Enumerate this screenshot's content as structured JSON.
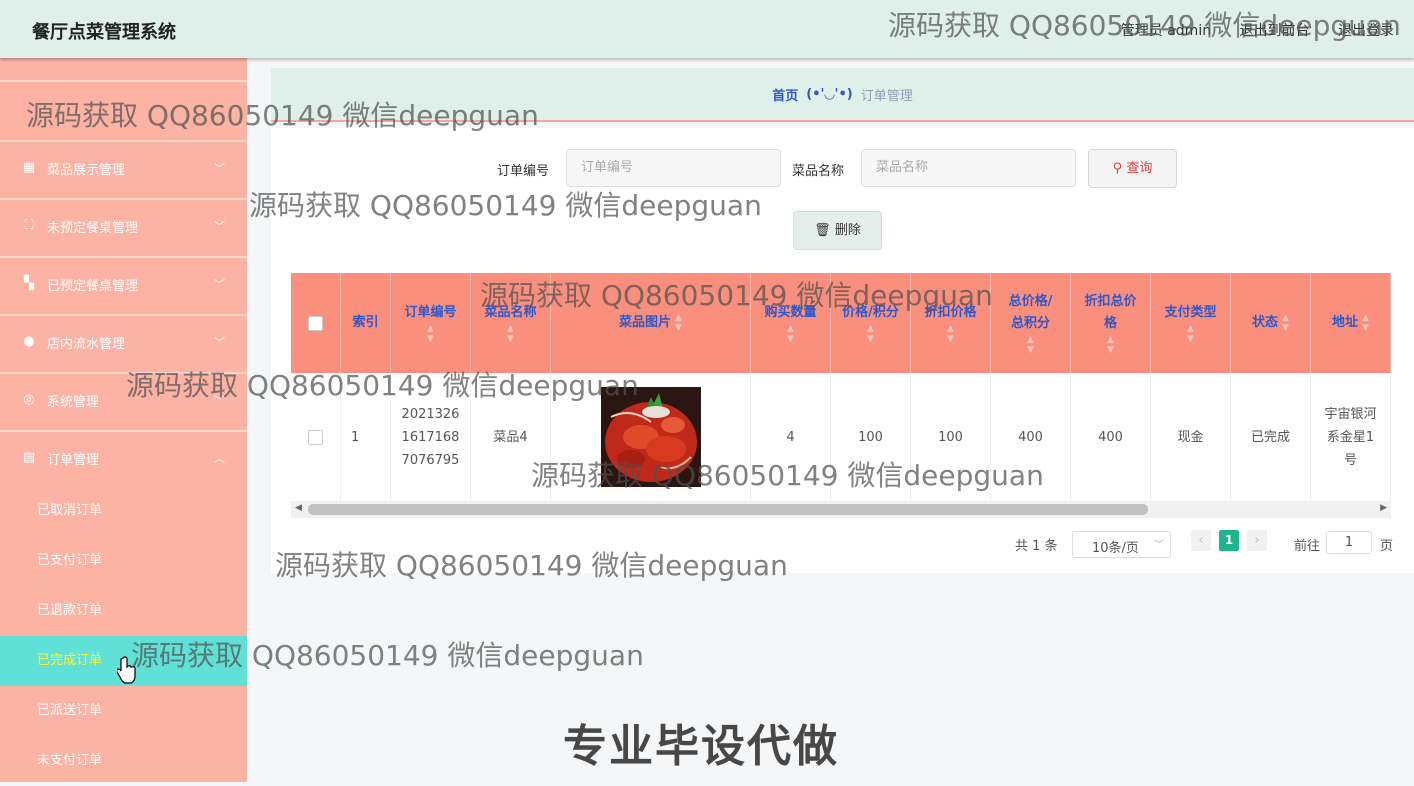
{
  "header": {
    "app_title": "餐厅点菜管理系统",
    "admin_label": "管理员 admin",
    "back_front": "退出到前台",
    "logout": "退出登录"
  },
  "sidebar": {
    "items": [
      {
        "label": "菜品展示管理",
        "icon": "grid-icon"
      },
      {
        "label": "未预定餐桌管理",
        "icon": "frame-icon"
      },
      {
        "label": "已预定餐桌管理",
        "icon": "tiles-icon"
      },
      {
        "label": "店内流水管理",
        "icon": "user-icon"
      },
      {
        "label": "系统管理",
        "icon": "compass-icon"
      },
      {
        "label": "订单管理",
        "icon": "clipboard-icon"
      }
    ],
    "sub_items": [
      "已取消订单",
      "已支付订单",
      "已退款订单",
      "已完成订单",
      "已派送订单",
      "未支付订单"
    ],
    "active_sub": "已完成订单"
  },
  "breadcrumb": {
    "home": "首页",
    "separator": "(•'◡'•)",
    "current": "订单管理"
  },
  "search": {
    "order_no_label": "订单编号",
    "order_no_placeholder": "订单编号",
    "dish_name_label": "菜品名称",
    "dish_name_placeholder": "菜品名称",
    "search_button": "查询",
    "delete_button": "删除"
  },
  "table": {
    "headers": [
      "索引",
      "订单编号",
      "菜品名称",
      "菜品图片",
      "购买数量",
      "价格/积分",
      "折扣价格",
      "总价格/总积分",
      "折扣总价格",
      "支付类型",
      "状态",
      "地址"
    ],
    "row": {
      "index": "1",
      "order_no": "20213261617168 7076795",
      "order_no_lines": [
        "2021326",
        "1617168",
        "7076795"
      ],
      "dish_name": "菜品4",
      "quantity": "4",
      "price": "100",
      "discount_price": "100",
      "total": "400",
      "discount_total": "400",
      "pay_type": "现金",
      "status": "已完成",
      "address_lines": [
        "宇宙银河",
        "系金星1",
        "号"
      ]
    }
  },
  "pagination": {
    "total": "共 1 条",
    "page_size": "10条/页",
    "current_page": "1",
    "goto_label": "前往",
    "goto_value": "1",
    "page_unit": "页"
  },
  "watermark": {
    "text": "源码获取 QQ86050149 微信deepguan",
    "banner": "专业毕设代做"
  },
  "colors": {
    "sidebar": "#fcb3a4",
    "header_bg": "#dff0ea",
    "table_header": "#fb8f7e",
    "active_item": "#5fe1d8",
    "accent": "#2e58c9",
    "page_active": "#1fb48c"
  }
}
